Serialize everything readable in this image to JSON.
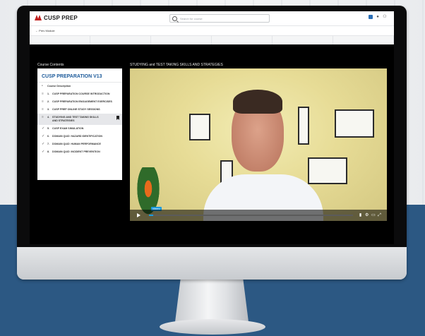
{
  "brand": {
    "name": "CUSP PREP",
    "accent": "#c0201f"
  },
  "search": {
    "placeholder": "Search for course"
  },
  "header_icons": [
    "notebook-icon",
    "user-icon",
    "users-icon"
  ],
  "breadcrumb": {
    "prev_module": "← Prev Module"
  },
  "course_contents_label": "Course Contents",
  "lesson_title": "STUDYING and TEST TAKING SKILLS AND STRATEGIES",
  "sidebar": {
    "title": "CUSP PREPARATION V13",
    "items": [
      {
        "icon": "dot-icon",
        "num": "",
        "label": "Course Description",
        "active": false
      },
      {
        "icon": "list-icon",
        "num": "1.",
        "label": "CUSP PREPARATION COURSE INTRODUCTION",
        "active": false
      },
      {
        "icon": "list-icon",
        "num": "2.",
        "label": "CUSP PREPARATION ENGAGEMENT EXERCISES",
        "active": false
      },
      {
        "icon": "list-icon",
        "num": "3.",
        "label": "CUSP PREP ONLINE STUDY SESSIONS",
        "active": false
      },
      {
        "icon": "list-icon",
        "num": "4.",
        "label": "STUDYING AND TEST TAKING SKILLS AND STRATEGIES",
        "active": true
      },
      {
        "icon": "check-icon",
        "num": "5.",
        "label": "CUSP EXAM SIMULATION",
        "active": false
      },
      {
        "icon": "check-icon",
        "num": "6.",
        "label": "DOMAIN QUIZ: HAZARD IDENTIFICATION",
        "active": false
      },
      {
        "icon": "check-icon",
        "num": "7.",
        "label": "DOMAIN QUIZ: HUMAN PERFORMANCE",
        "active": false
      },
      {
        "icon": "check-icon",
        "num": "8.",
        "label": "DOMAIN QUIZ: INCIDENT PREVENTION",
        "active": false
      }
    ]
  },
  "video": {
    "badge": "vimeo",
    "progress": 0.02,
    "accent": "#1a9be0"
  },
  "colors": {
    "backdrop_blue": "#2c5883",
    "sidebar_title": "#1c5a9a"
  }
}
